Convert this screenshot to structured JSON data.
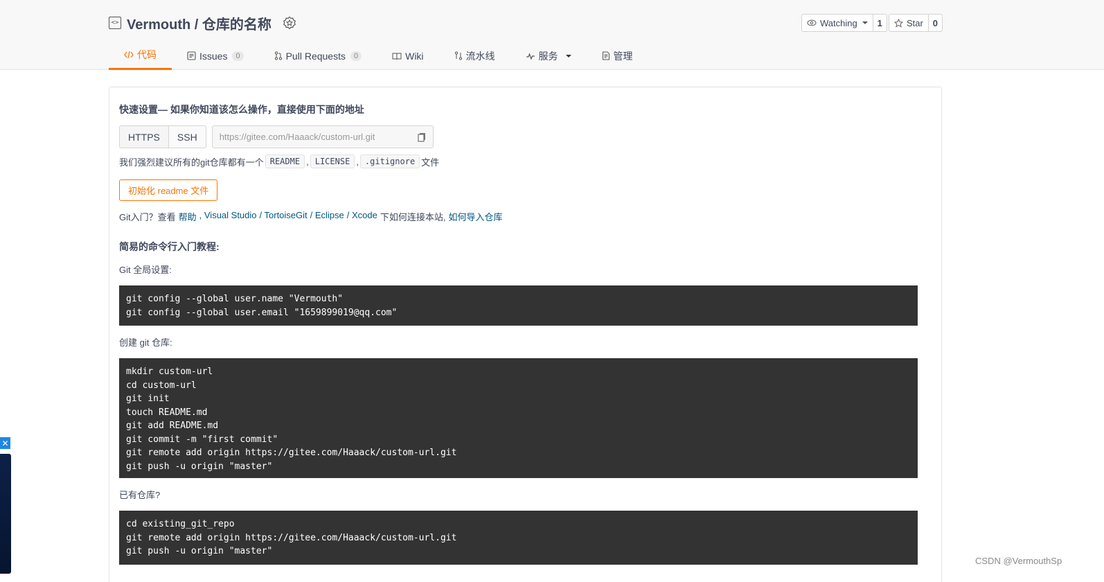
{
  "repo": {
    "title": "Vermouth / 仓库的名称",
    "icon": "code-repo-icon",
    "recommend_icon": "recommend-badge-icon"
  },
  "watch": {
    "label": "Watching",
    "count": "1",
    "icon": "eye-icon"
  },
  "star": {
    "label": "Star",
    "count": "0",
    "icon": "star-icon"
  },
  "tabs": [
    {
      "label": "代码",
      "icon": "code-icon",
      "active": true
    },
    {
      "label": "Issues",
      "badge": "0",
      "icon": "issues-icon"
    },
    {
      "label": "Pull Requests",
      "badge": "0",
      "icon": "pull-request-icon"
    },
    {
      "label": "Wiki",
      "icon": "book-icon"
    },
    {
      "label": "流水线",
      "icon": "pipeline-icon"
    },
    {
      "label": "服务",
      "icon": "pulse-icon",
      "dropdown": true
    },
    {
      "label": "管理",
      "icon": "settings-doc-icon"
    }
  ],
  "quick": {
    "title": "快速设置— 如果你知道该怎么操作，直接使用下面的地址",
    "https_label": "HTTPS",
    "ssh_label": "SSH",
    "url": "https://gitee.com/Haaack/custom-url.git",
    "copy_icon": "copy-icon"
  },
  "recommend": {
    "prefix": "我们强烈建议所有的git仓库都有一个",
    "chips": [
      "README",
      "LICENSE",
      ".gitignore"
    ],
    "sep1": ",",
    "sep2": ",",
    "suffix": "文件"
  },
  "init_button": "初始化 readme 文件",
  "help": {
    "prefix": "Git入门？查看",
    "links": [
      "帮助",
      ", Visual Studio",
      "/ TortoiseGit",
      "/ Eclipse",
      "/ Xcode"
    ],
    "middle": "下如何连接本站,",
    "import_link": "如何导入仓库"
  },
  "tutorial_title": "简易的命令行入门教程:",
  "sections": {
    "global_label": "Git 全局设置:",
    "global_code": [
      "git config --global user.name \"Vermouth\"",
      "git config --global user.email \"1659899019@qq.com\""
    ],
    "create_label": "创建 git 仓库:",
    "create_code": [
      "mkdir custom-url",
      "cd custom-url",
      "git init",
      "touch README.md",
      "git add README.md",
      "git commit -m \"first commit\"",
      "git remote add origin https://gitee.com/Haaack/custom-url.git",
      "git push -u origin \"master\""
    ],
    "existing_label": "已有仓库?",
    "existing_code": [
      "cd existing_git_repo",
      "git remote add origin https://gitee.com/Haaack/custom-url.git",
      "git push -u origin \"master\""
    ]
  },
  "watermark": "CSDN @VermouthSp",
  "colors": {
    "accent": "#fe7300",
    "link": "#005980",
    "code_bg": "#333333"
  }
}
